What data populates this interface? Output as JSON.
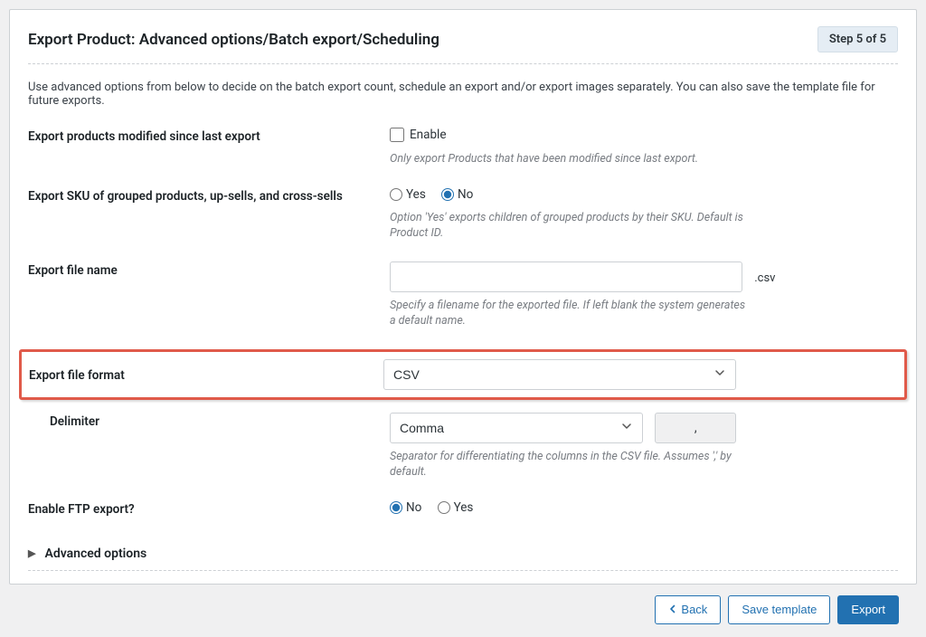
{
  "header": {
    "title": "Export Product: Advanced options/Batch export/Scheduling",
    "step_badge": "Step 5 of 5"
  },
  "intro": "Use advanced options from below to decide on the batch export count, schedule an export and/or export images separately. You can also save the template file for future exports.",
  "fields": {
    "modified_since": {
      "label": "Export products modified since last export",
      "checkbox_label": "Enable",
      "hint": "Only export Products that have been modified since last export."
    },
    "grouped_sku": {
      "label": "Export SKU of grouped products, up-sells, and cross-sells",
      "yes": "Yes",
      "no": "No",
      "hint": "Option 'Yes' exports children of grouped products by their SKU. Default is Product ID."
    },
    "file_name": {
      "label": "Export file name",
      "value": "",
      "ext": ".csv",
      "hint": "Specify a filename for the exported file. If left blank the system generates a default name."
    },
    "file_format": {
      "label": "Export file format",
      "value": "CSV"
    },
    "delimiter": {
      "label": "Delimiter",
      "value": "Comma",
      "char": ",",
      "hint": "Separator for differentiating the columns in the CSV file. Assumes ',' by default."
    },
    "ftp": {
      "label": "Enable FTP export?",
      "no": "No",
      "yes": "Yes"
    }
  },
  "advanced_toggle": "Advanced options",
  "footer": {
    "back": "Back",
    "save_template": "Save template",
    "export": "Export"
  }
}
